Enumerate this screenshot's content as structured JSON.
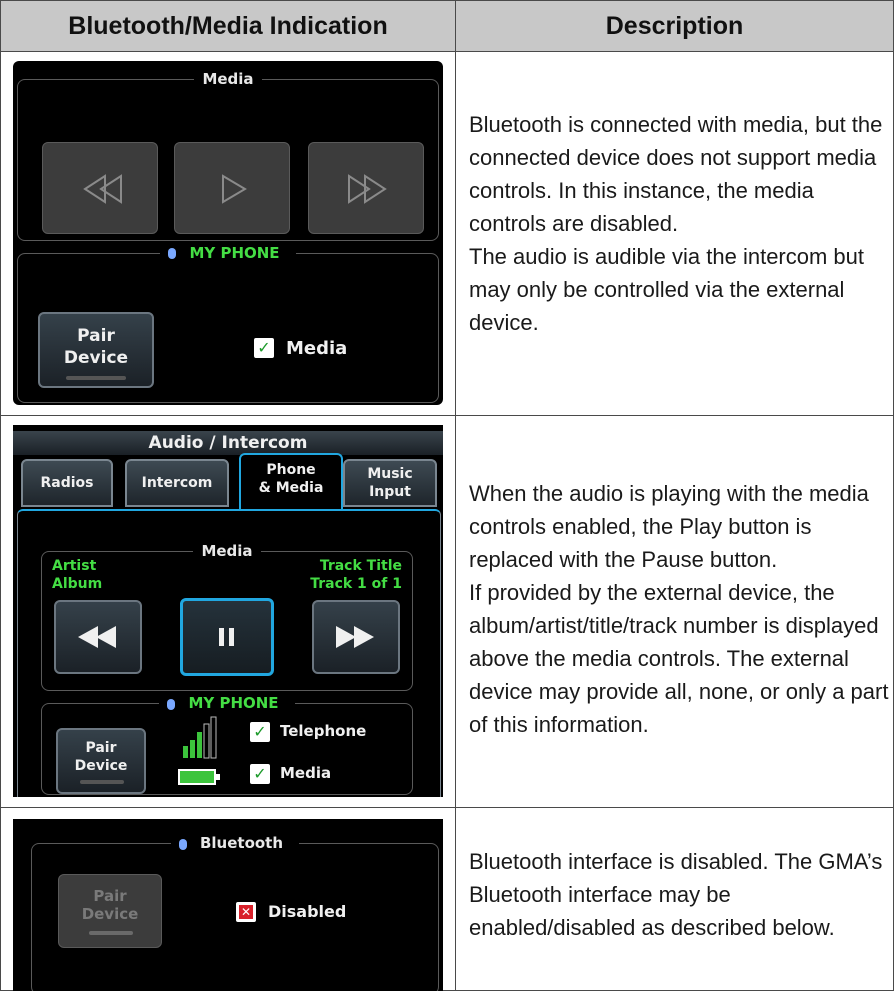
{
  "table": {
    "col1_header": "Bluetooth/Media Indication",
    "col2_header": "Description"
  },
  "row1": {
    "media_title": "Media",
    "phone_title": "MY PHONE",
    "pair_button": [
      "Pair",
      "Device"
    ],
    "media_checkbox_label": "Media",
    "desc": [
      "Bluetooth is connected with media, but the connected device does not support media controls.  In this instance, the media controls are disabled.",
      "The audio is audible via the intercom but may only be controlled via the external device."
    ]
  },
  "row2": {
    "window_title": "Audio / Intercom",
    "tabs": [
      {
        "label": "Radios"
      },
      {
        "label": "Intercom"
      },
      {
        "label": "Phone\n& Media"
      },
      {
        "label": "Music\nInput"
      }
    ],
    "media_title": "Media",
    "artist": "Artist",
    "album": "Album",
    "track_title": "Track Title",
    "track_number": "Track 1 of 1",
    "phone_title": "MY PHONE",
    "pair_button": [
      "Pair",
      "Device"
    ],
    "telephone_label": "Telephone",
    "media_label": "Media",
    "desc": [
      "When the audio is playing with the media controls enabled, the Play button is replaced with the Pause button.",
      "If provided by the external device, the album/artist/title/track number is displayed above the media controls.  The external device may provide all, none, or only a part of this information."
    ]
  },
  "row3": {
    "bt_title": "Bluetooth",
    "pair_button": [
      "Pair",
      "Device"
    ],
    "disabled_label": "Disabled",
    "desc": [
      "Bluetooth interface is disabled.  The GMA’s Bluetooth interface may be enabled/disabled as described below."
    ]
  },
  "colors": {
    "accent_green": "#44dd44",
    "selection_blue": "#21a7e0",
    "header_gray": "#c8c8c8"
  }
}
